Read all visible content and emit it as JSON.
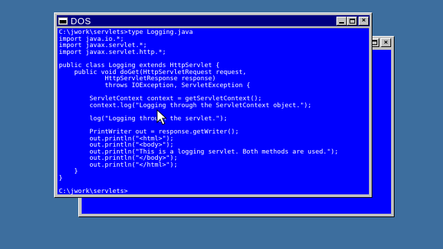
{
  "desktop": {
    "background_color": "#3d6e9e"
  },
  "back_window": {
    "client_color": "#0000ff"
  },
  "front_window": {
    "title": "DOS",
    "title_icon": "dos-window-icon",
    "titlebar_color": "#000080",
    "client_color": "#0000ff",
    "text_color": "#ffffff",
    "buttons": {
      "minimize": "minimize",
      "maximize": "maximize",
      "close": "×"
    }
  },
  "console": {
    "lines": [
      "C:\\jwork\\servlets>type Logging.java",
      "import java.io.*;",
      "import javax.servlet.*;",
      "import javax.servlet.http.*;",
      "",
      "public class Logging extends HttpServlet {",
      "    public void doGet(HttpServletRequest request,",
      "            HttpServletResponse response)",
      "            throws IOException, ServletException {",
      "",
      "        ServletContext context = getServletContext();",
      "        context.log(\"Logging through the ServletContext object.\");",
      "",
      "        log(\"Logging through the servlet.\");",
      "",
      "        PrintWriter out = response.getWriter();",
      "        out.println(\"<html>\");",
      "        out.println(\"<body>\");",
      "        out.println(\"This is a logging servlet. Both methods are used.\");",
      "        out.println(\"</body>\");",
      "        out.println(\"</html>\");",
      "    }",
      "}",
      "",
      "C:\\jwork\\servlets>"
    ]
  },
  "mouse_pointer": {
    "icon": "arrow-cursor-icon"
  }
}
